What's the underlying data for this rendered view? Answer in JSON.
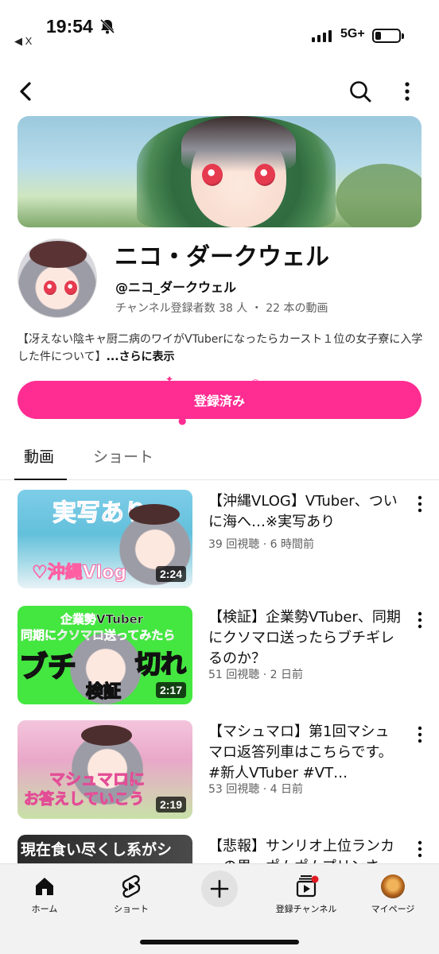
{
  "status_bar": {
    "time": "19:54",
    "back_app": "◀ X",
    "network": "5G+"
  },
  "channel": {
    "name": "ニコ・ダークウェル",
    "handle": "@ニコ_ダークウェル",
    "stats": "チャンネル登録者数 38 人 ・ 22 本の動画",
    "description": "【冴えない陰キャ厨二病のワイがVTuberになったらカースト１位の女子寮に入学した件について】",
    "description_more": "...さらに表示",
    "subscribe_label": "登録済み"
  },
  "tabs": [
    {
      "label": "動画",
      "selected": true
    },
    {
      "label": "ショート",
      "selected": false
    }
  ],
  "videos": [
    {
      "title": "【沖縄VLOG】VTuber、ついに海へ…※実写あり",
      "meta": "39 回視聴 · 6 時間前",
      "duration": "2:24",
      "thumb_text_top": "実写あり",
      "thumb_text_bottom": "♡沖縄Vlog"
    },
    {
      "title": "【検証】企業勢VTuber、同期にクソマロ送ったらブチギレるのか？",
      "meta": "51 回視聴 · 2 日前",
      "duration": "2:17",
      "thumb_text_line1": "企業勢VTuber",
      "thumb_text_line2": "同期にクソマロ送ってみたら",
      "thumb_text_left": "ブチ",
      "thumb_text_right": "切れ",
      "thumb_text_bottom": "検証"
    },
    {
      "title": "【マシュマロ】第1回マシュマロ返答列車はこちらです。 #新人VTuber #VT…",
      "meta": "53 回視聴 · 4 日前",
      "duration": "2:19",
      "thumb_text_line1": "マシュマロに",
      "thumb_text_line2": "お答えしていこう"
    },
    {
      "title": "【悲報】サンリオ上位ランカーの男、ポムポムプリンさ",
      "thumb_text_top": "現在食い尽くし系がシ"
    }
  ],
  "bottom_nav": [
    {
      "label": "ホーム",
      "icon": "home-icon"
    },
    {
      "label": "ショート",
      "icon": "shorts-icon"
    },
    {
      "label": "",
      "icon": "create-icon"
    },
    {
      "label": "登録チャンネル",
      "icon": "subscriptions-icon"
    },
    {
      "label": "マイページ",
      "icon": "avatar"
    }
  ],
  "colors": {
    "accent": "#ff2d92",
    "text": "#0f0f0f",
    "secondary_text": "#606060",
    "nav_bg": "#f2f2f2"
  }
}
